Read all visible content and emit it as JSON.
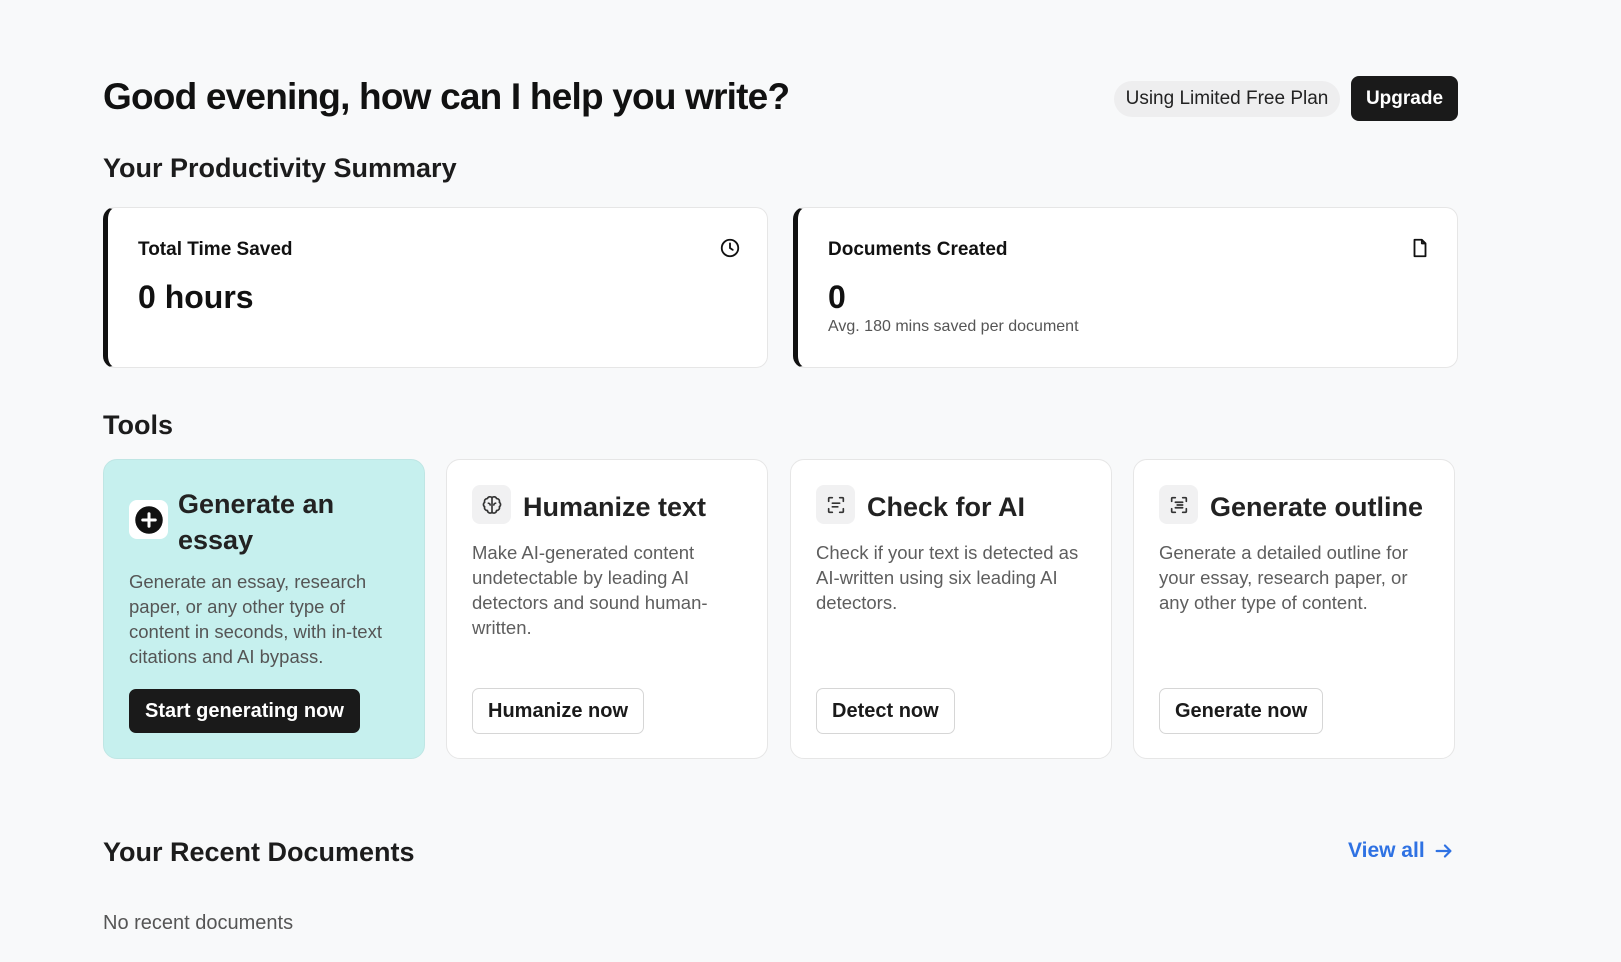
{
  "header": {
    "greeting": "Good evening, how can I help you write?",
    "plan_label": "Using Limited Free Plan",
    "upgrade_label": "Upgrade"
  },
  "summary": {
    "title": "Your Productivity Summary",
    "cards": [
      {
        "label": "Total Time Saved",
        "value": "0 hours",
        "icon": "clock-icon"
      },
      {
        "label": "Documents Created",
        "value": "0",
        "sub": "Avg. 180 mins saved per document",
        "icon": "document-icon"
      }
    ]
  },
  "tools": {
    "title": "Tools",
    "items": [
      {
        "title": "Generate an essay",
        "description": "Generate an essay, research paper, or any other type of content in seconds, with in-text citations and AI bypass.",
        "button": "Start generating now",
        "icon": "plus-circle-icon"
      },
      {
        "title": "Humanize text",
        "description": "Make AI-generated content undetectable by leading AI detectors and sound human-written.",
        "button": "Humanize now",
        "icon": "brain-icon"
      },
      {
        "title": "Check for AI",
        "description": "Check if your text is detected as AI-written using six leading AI detectors.",
        "button": "Detect now",
        "icon": "scan-icon"
      },
      {
        "title": "Generate outline",
        "description": "Generate a detailed outline for your essay, research paper, or any other type of content.",
        "button": "Generate now",
        "icon": "outline-scan-icon"
      }
    ]
  },
  "recent": {
    "title": "Your Recent Documents",
    "view_all": "View all",
    "empty": "No recent documents"
  },
  "colors": {
    "accent_link": "#2f72e3",
    "primary_dark": "#1a1a1a",
    "highlight_card": "#c6f0ee",
    "background": "#f8f9fa"
  }
}
